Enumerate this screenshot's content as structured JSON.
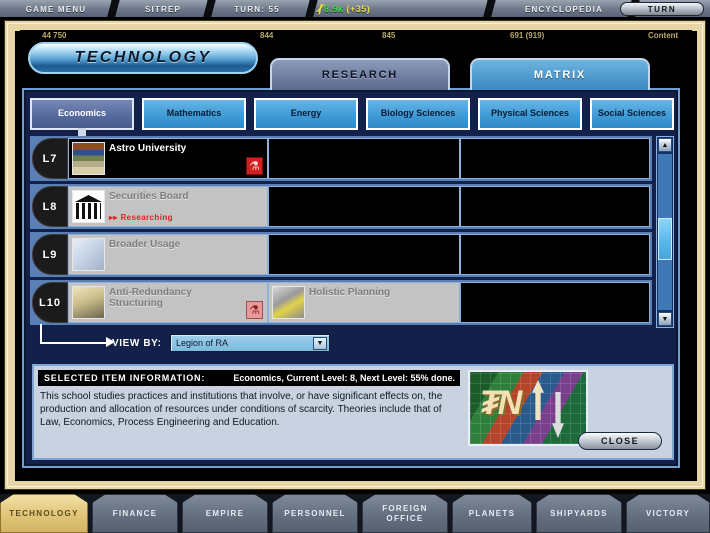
{
  "topbar": {
    "game_menu": "GAME MENU",
    "sitrep": "SITREP",
    "turn": "TURN: 55",
    "resource_icon": "research-icon",
    "resource_amount": "8.9k",
    "resource_delta": "(+35)",
    "encyclopedia": "ENCYCLOPEDIA",
    "turn_button": "TURN"
  },
  "stats_strip": [
    {
      "value": "44 750"
    },
    {
      "value": "844"
    },
    {
      "value": "845"
    },
    {
      "value": "691 (919)"
    },
    {
      "value": "Content"
    }
  ],
  "screen": {
    "title": "TECHNOLOGY",
    "tabs": [
      {
        "label": "RESEARCH",
        "active": false
      },
      {
        "label": "MATRIX",
        "active": true
      }
    ]
  },
  "categories": [
    {
      "label": "Economics",
      "active": true
    },
    {
      "label": "Mathematics",
      "active": false
    },
    {
      "label": "Energy",
      "active": false
    },
    {
      "label": "Biology Sciences",
      "active": false
    },
    {
      "label": "Physical Sciences",
      "active": false
    },
    {
      "label": "Social Sciences",
      "active": false
    }
  ],
  "tech_rows": [
    {
      "level": "L7",
      "cells": [
        {
          "name": "Astro University",
          "state": "researched",
          "icon": "books-icon",
          "flask": "red",
          "status": ""
        },
        {
          "name": "",
          "state": "empty",
          "icon": "",
          "flask": "",
          "status": ""
        },
        {
          "name": "",
          "state": "empty",
          "icon": "",
          "flask": "",
          "status": ""
        }
      ]
    },
    {
      "level": "L8",
      "cells": [
        {
          "name": "Securities Board",
          "state": "researching",
          "icon": "bank-icon",
          "flask": "",
          "status": "Researching"
        },
        {
          "name": "",
          "state": "empty",
          "icon": "",
          "flask": "",
          "status": ""
        },
        {
          "name": "",
          "state": "empty",
          "icon": "",
          "flask": "",
          "status": ""
        }
      ]
    },
    {
      "level": "L9",
      "cells": [
        {
          "name": "Broader Usage",
          "state": "available",
          "icon": "people-icon",
          "flask": "",
          "status": ""
        },
        {
          "name": "",
          "state": "empty",
          "icon": "",
          "flask": "",
          "status": ""
        },
        {
          "name": "",
          "state": "empty",
          "icon": "",
          "flask": "",
          "status": ""
        }
      ]
    },
    {
      "level": "L10",
      "cells": [
        {
          "name": "Anti-Redundancy Structuring",
          "state": "available",
          "icon": "desert-icon",
          "flask": "pale",
          "status": ""
        },
        {
          "name": "Holistic Planning",
          "state": "available",
          "icon": "plan-icon",
          "flask": "",
          "status": ""
        },
        {
          "name": "",
          "state": "empty",
          "icon": "",
          "flask": "",
          "status": ""
        }
      ]
    }
  ],
  "scrollbar": {
    "up_glyph": "▲",
    "down_glyph": "▼"
  },
  "view_by": {
    "label": "VIEW BY:",
    "value": "Legion of RA",
    "caret": "▼"
  },
  "info": {
    "heading": "SELECTED ITEM INFORMATION:",
    "meta": "Economics, Current Level: 8, Next Level: 55% done.",
    "description": "This school studies practices and institutions that involve, or have significant effects on, the production and allocation of resources under conditions of scarcity. Theories include that of Law, Economics, Process Engineering and Education.",
    "art_glyph": "₮N",
    "close_label": "CLOSE"
  },
  "bottom_nav": [
    {
      "label": "TECHNOLOGY",
      "active": true
    },
    {
      "label": "FINANCE",
      "active": false
    },
    {
      "label": "EMPIRE",
      "active": false
    },
    {
      "label": "PERSONNEL",
      "active": false
    },
    {
      "label": "FOREIGN OFFICE",
      "active": false
    },
    {
      "label": "PLANETS",
      "active": false
    },
    {
      "label": "SHIPYARDS",
      "active": false
    },
    {
      "label": "VICTORY",
      "active": false
    }
  ],
  "colors": {
    "frame_tan": "#e7d5a8",
    "panel_blue": "#12204a",
    "accent_cyan": "#5fb4e6",
    "active_tab_gold": "#e0c478",
    "status_red": "#e02020"
  }
}
